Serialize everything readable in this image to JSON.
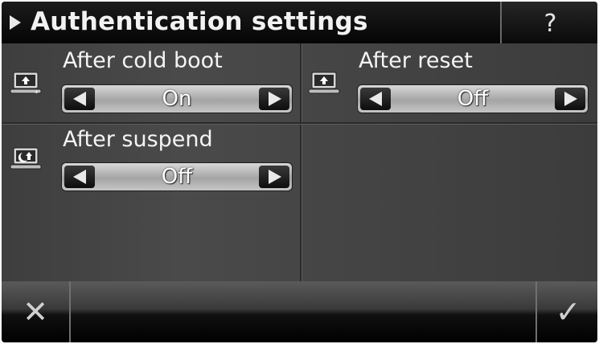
{
  "header": {
    "title": "Authentication settings",
    "help_label": "?",
    "title_arrow_icon": "play-arrow-icon"
  },
  "settings": [
    {
      "label": "After cold boot",
      "value": "On",
      "icon": "cold-boot-laptop-icon"
    },
    {
      "label": "After reset",
      "value": "Off",
      "icon": "reset-laptop-icon"
    },
    {
      "label": "After suspend",
      "value": "Off",
      "icon": "suspend-laptop-icon"
    }
  ],
  "footer": {
    "cancel_glyph": "✕",
    "confirm_glyph": "✓",
    "cancel_icon": "close-icon",
    "confirm_icon": "checkmark-icon"
  },
  "colors": {
    "title_bar": "#0a0a0a",
    "panel": "#444444",
    "selector": "#c0c0c0",
    "text": "#f4f4f4"
  }
}
